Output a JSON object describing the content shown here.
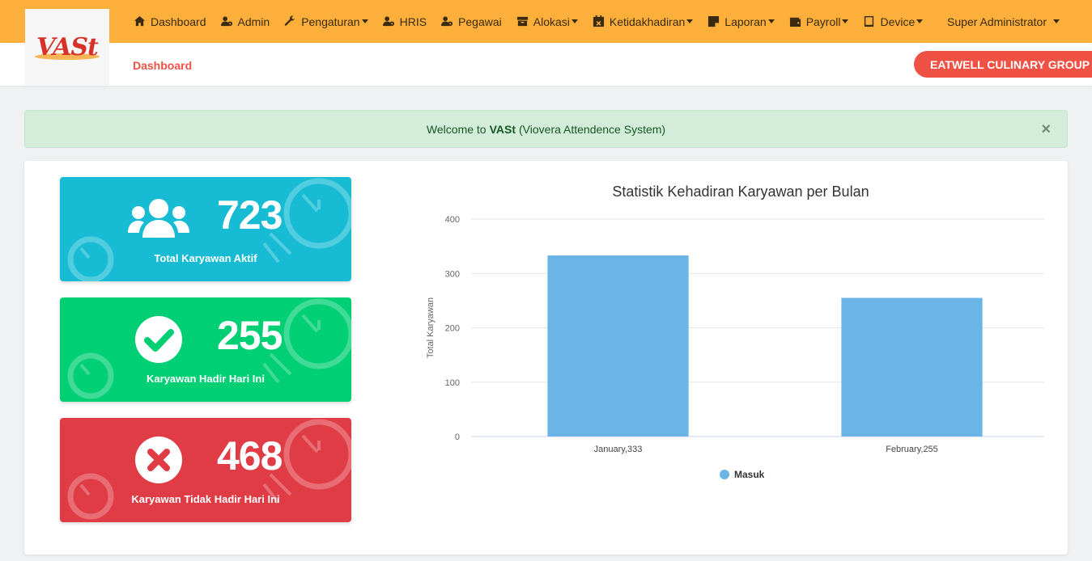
{
  "nav": {
    "items": [
      {
        "label": "Dashboard",
        "icon": "home-icon",
        "caret": false
      },
      {
        "label": "Admin",
        "icon": "users-cog-icon",
        "caret": false
      },
      {
        "label": "Pengaturan",
        "icon": "wrench-icon",
        "caret": true
      },
      {
        "label": "HRIS",
        "icon": "users-cog-icon",
        "caret": false
      },
      {
        "label": "Pegawai",
        "icon": "users-cog-icon",
        "caret": false
      },
      {
        "label": "Alokasi",
        "icon": "archive-icon",
        "caret": true
      },
      {
        "label": "Ketidakhadiran",
        "icon": "calendar-times-icon",
        "caret": true
      },
      {
        "label": "Laporan",
        "icon": "sticky-note-icon",
        "caret": true
      },
      {
        "label": "Payroll",
        "icon": "wallet-icon",
        "caret": true
      },
      {
        "label": "Device",
        "icon": "tablet-icon",
        "caret": true
      }
    ],
    "user": "Super Administrator"
  },
  "logo": {
    "text": "VASt"
  },
  "breadcrumb": "Dashboard",
  "company": "EATWELL CULINARY GROUP",
  "alert": {
    "prefix": "Welcome to",
    "brand": "VASt",
    "suffix": "(Viovera Attendence System)",
    "close": "×"
  },
  "stats": [
    {
      "value": "723",
      "label": "Total Karyawan Aktif",
      "icon": "users-icon",
      "color": "#17bcd4"
    },
    {
      "value": "255",
      "label": "Karyawan Hadir Hari Ini",
      "icon": "check-circle-icon",
      "color": "#00cf74"
    },
    {
      "value": "468",
      "label": "Karyawan Tidak Hadir Hari Ini",
      "icon": "times-circle-icon",
      "color": "#e03c46"
    }
  ],
  "chart_data": {
    "type": "bar",
    "title": "Statistik Kehadiran Karyawan per Bulan",
    "ylabel": "Total Karyawan",
    "xlabel": "",
    "categories": [
      "January,333",
      "February,255"
    ],
    "series": [
      {
        "name": "Masuk",
        "values": [
          333,
          255
        ],
        "color": "#6ab5e6"
      }
    ],
    "ylim": [
      0,
      400
    ],
    "yticks": [
      0,
      100,
      200,
      300,
      400
    ],
    "grid": true,
    "legend": "bottom"
  }
}
